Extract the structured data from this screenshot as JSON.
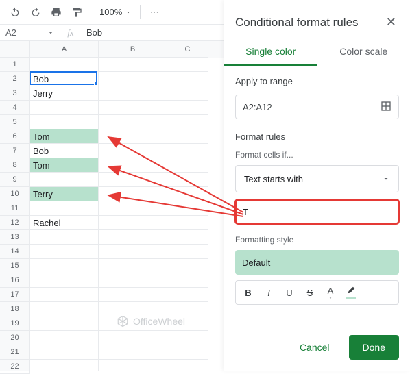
{
  "toolbar": {
    "zoom": "100%"
  },
  "namebox": {
    "ref": "A2",
    "formula_value": "Bob"
  },
  "columns": [
    "A",
    "B",
    "C"
  ],
  "rows_data": {
    "2": "Bob",
    "3": "Jerry",
    "6": "Tom",
    "7": "Bob",
    "8": "Tom",
    "10": "Terry",
    "12": "Rachel"
  },
  "highlighted_rows": [
    6,
    8,
    10
  ],
  "panel": {
    "title": "Conditional format rules",
    "tabs": {
      "single": "Single color",
      "scale": "Color scale"
    },
    "apply_label": "Apply to range",
    "range": "A2:A12",
    "rules_label": "Format rules",
    "cells_if_label": "Format cells if...",
    "condition": "Text starts with",
    "value": "T",
    "style_label": "Formatting style",
    "style_name": "Default",
    "cancel": "Cancel",
    "done": "Done"
  },
  "watermark": "OfficeWheel"
}
